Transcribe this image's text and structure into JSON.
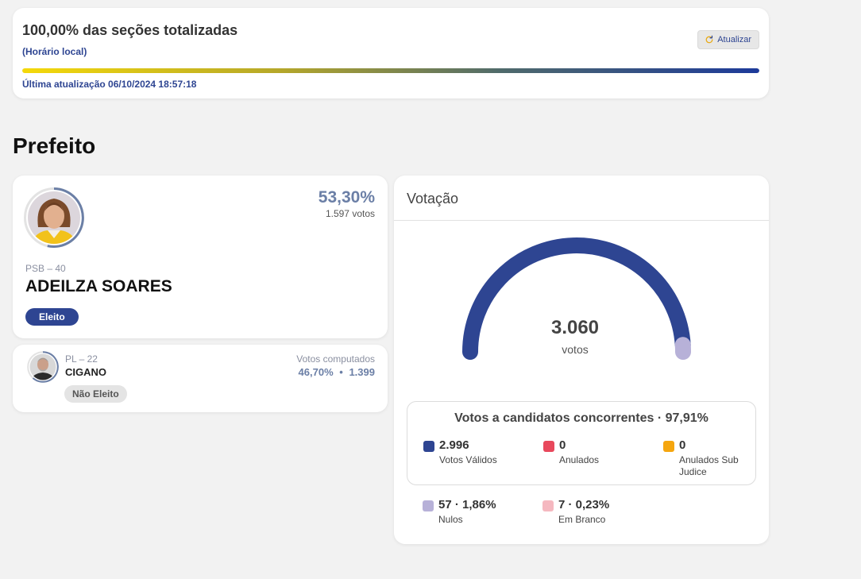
{
  "status": {
    "title": "100,00% das seções totalizadas",
    "subtitle": "(Horário local)",
    "refresh_label": "Atualizar",
    "progress_fraction": 1.0,
    "last_update": "Última atualização 06/10/2024 18:57:18"
  },
  "section_title": "Prefeito",
  "candidates": [
    {
      "party": "PSB – 40",
      "name": "ADEILZA SOARES",
      "percent": "53,30%",
      "votes": "1.597 votos",
      "status": "Eleito"
    },
    {
      "party": "PL – 22",
      "name": "CIGANO",
      "computed_label": "Votos computados",
      "percent": "46,70%",
      "bullet": "•",
      "votes": "1.399",
      "status": "Não Eleito"
    }
  ],
  "votacao": {
    "title": "Votação",
    "total": "3.060",
    "total_unit": "votos",
    "valid_title": "Votos a candidatos concorrentes · 97,91%",
    "stats": {
      "validos": {
        "value": "2.996",
        "label": "Votos Válidos",
        "color": "#2e4592"
      },
      "anulados": {
        "value": "0",
        "label": "Anulados",
        "color": "#e8485c"
      },
      "sub_judice": {
        "value": "0",
        "label": "Anulados Sub Judice",
        "color": "#f5a60f"
      },
      "nulos": {
        "value": "57 · 1,86%",
        "label": "Nulos",
        "color": "#b7b1d8"
      },
      "branco": {
        "value": "7 · 0,23%",
        "label": "Em Branco",
        "color": "#f5b8c0"
      }
    },
    "gauge": {
      "valid_fraction": 0.9791,
      "main_color": "#2e4592",
      "rest_color": "#b7b1d8"
    }
  },
  "colors": {
    "accent": "#2e4592",
    "background": "#f2f2f2"
  }
}
